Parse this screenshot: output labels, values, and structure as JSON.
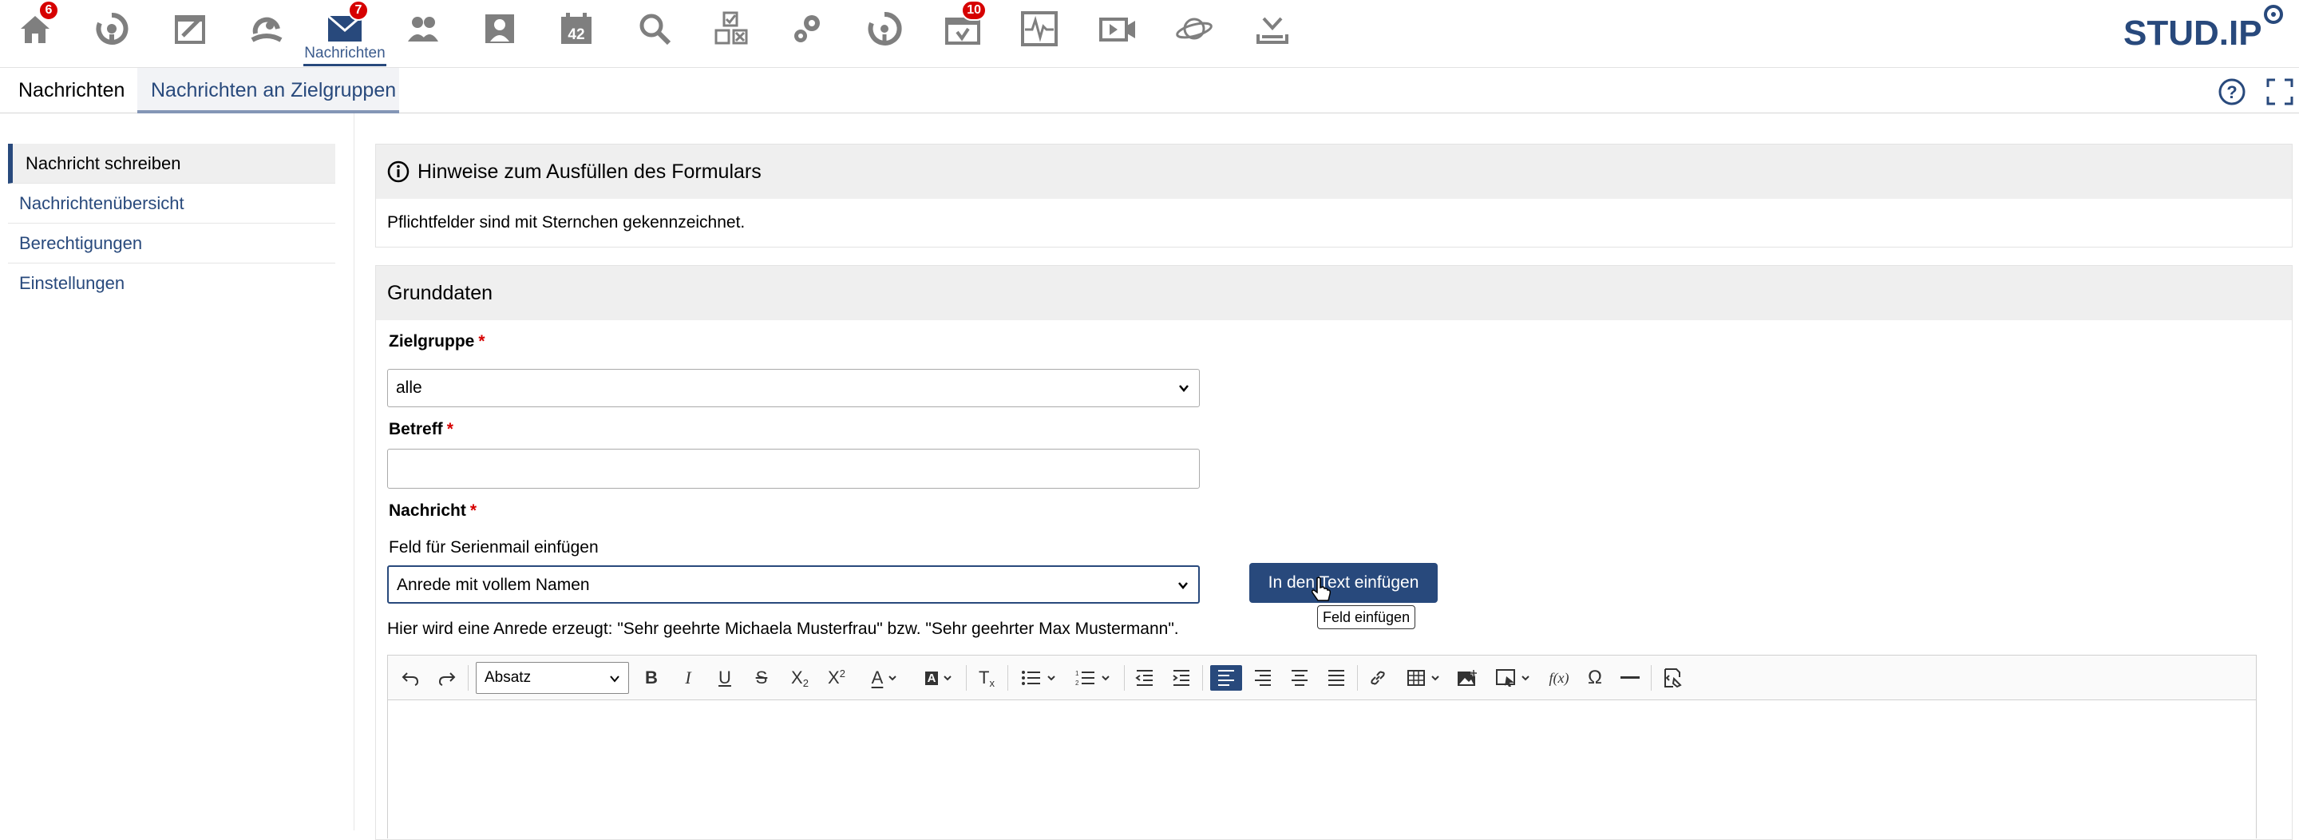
{
  "topnav": {
    "badges": {
      "start": "6",
      "messages": "7",
      "tools": "10"
    },
    "active_label": "Nachrichten",
    "logo_text": "STUD.IP"
  },
  "tabs": [
    "Nachrichten",
    "Nachrichten an Zielgruppen"
  ],
  "sidebar": {
    "items": [
      "Nachricht schreiben",
      "Nachrichtenübersicht",
      "Berechtigungen",
      "Einstellungen"
    ]
  },
  "hint_box": {
    "title": "Hinweise zum Ausfüllen des Formulars",
    "text": "Pflichtfelder sind mit Sternchen gekennzeichnet."
  },
  "form": {
    "section_title": "Grunddaten",
    "target_label": "Zielgruppe",
    "target_value": "alle",
    "subject_label": "Betreff",
    "subject_value": "",
    "message_label": "Nachricht",
    "required_mark": "*",
    "serial_label": "Feld für Serienmail einfügen",
    "serial_value": "Anrede mit vollem Namen",
    "insert_button": "In den Text einfügen",
    "tooltip": "Feld einfügen",
    "serial_hint": "Hier wird eine Anrede erzeugt: \"Sehr geehrte Michaela Musterfrau\" bzw. \"Sehr geehrter Max Mustermann\"."
  },
  "editor": {
    "format_value": "Absatz",
    "formula_label": "f(x)",
    "omega_label": "Ω"
  }
}
